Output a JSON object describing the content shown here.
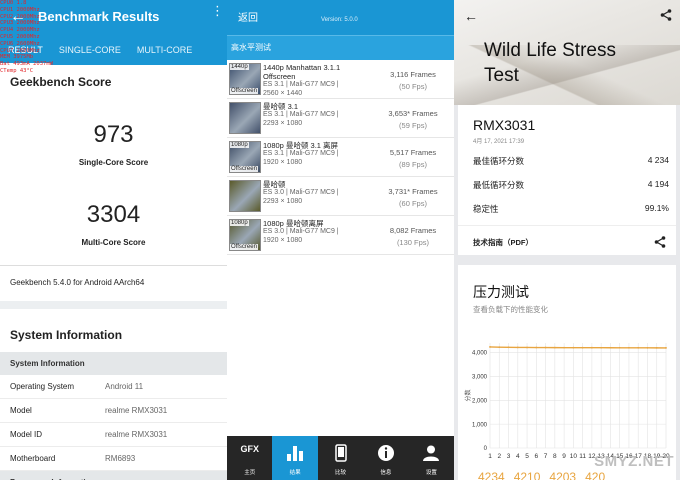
{
  "geekbench": {
    "app_title": "Benchmark Results",
    "overlay_lines": [
      "CPU0 1.8",
      "CPU1 2000Mhz",
      "CPU2 2000Mhz",
      "CPU3 2000Mhz",
      "CPU4 2000Mhz",
      "CPU5 2000Mhz",
      "CPU6 2600Mhz",
      "CPU7 2600Mhz",
      "MEM 3975Mb",
      "Bat 493mA 2037mW",
      "CTemp 43°C"
    ],
    "tabs": [
      "RESULT",
      "SINGLE-CORE",
      "MULTI-CORE"
    ],
    "score_heading": "Geekbench Score",
    "single_core_score": "973",
    "single_core_label": "Single-Core Score",
    "multi_core_score": "3304",
    "multi_core_label": "Multi-Core Score",
    "version_text": "Geekbench 5.4.0 for Android AArch64",
    "system_information_title": "System Information",
    "system_information_subhead": "System Information",
    "rows": [
      {
        "key": "Operating System",
        "value": "Android 11"
      },
      {
        "key": "Model",
        "value": "realme RMX3031"
      },
      {
        "key": "Model ID",
        "value": "realme RMX3031"
      },
      {
        "key": "Motherboard",
        "value": "RM6893"
      }
    ],
    "processor_subhead": "Processor Information"
  },
  "gfx": {
    "back_label": "返回",
    "version": "Version: 5.0.0",
    "section_title": "高水平测试",
    "tests": [
      {
        "thumb_tag": "1440p",
        "thumb_tag2": "Offscreen",
        "name": "1440p Manhattan 3.1.1 Offscreen",
        "api": "ES 3.1 | Mali-G77 MC9 |",
        "res": "2560 × 1440",
        "frames": "3,116 Frames",
        "fps": "(50 Fps)",
        "color": "#3a4d6b"
      },
      {
        "thumb_tag": "",
        "thumb_tag2": "",
        "name": "曼哈顿 3.1",
        "api": "ES 3.1 | Mali-G77 MC9 |",
        "res": "2293 × 1080",
        "frames": "3,653* Frames",
        "fps": "(59 Fps)",
        "color": "#42506a"
      },
      {
        "thumb_tag": "1080p",
        "thumb_tag2": "Offscreen",
        "name": "1080p 曼哈顿 3.1 离屏",
        "api": "ES 3.1 | Mali-G77 MC9 |",
        "res": "1920 × 1080",
        "frames": "5,517 Frames",
        "fps": "(89 Fps)",
        "color": "#3b4a63"
      },
      {
        "thumb_tag": "",
        "thumb_tag2": "",
        "name": "曼哈顿",
        "api": "ES 3.0 | Mali-G77 MC9 |",
        "res": "2293 × 1080",
        "frames": "3,731* Frames",
        "fps": "(60 Fps)",
        "color": "#5a5a2a"
      },
      {
        "thumb_tag": "1080p",
        "thumb_tag2": "Offscreen",
        "name": "1080p 曼哈顿离屏",
        "api": "ES 3.0 | Mali-G77 MC9 |",
        "res": "1920 × 1080",
        "frames": "8,082 Frames",
        "fps": "(130 Fps)",
        "color": "#56582c"
      }
    ],
    "nav": [
      {
        "label": "主页",
        "icon": "gfx-logo-icon",
        "glyph": "GFX"
      },
      {
        "label": "结果",
        "icon": "bar-chart-icon",
        "glyph": ""
      },
      {
        "label": "比较",
        "icon": "phone-icon",
        "glyph": ""
      },
      {
        "label": "信息",
        "icon": "info-icon",
        "glyph": "i"
      },
      {
        "label": "设置",
        "icon": "user-icon",
        "glyph": ""
      }
    ]
  },
  "threedmark": {
    "title_line1": "Wild Life Stress",
    "title_line2": "Test",
    "device": "RMX3031",
    "date": "4月 17, 2021 17:39",
    "best_label": "最佳循环分数",
    "best_value": "4 234",
    "lowest_label": "最低循环分数",
    "lowest_value": "4 194",
    "stability_label": "稳定性",
    "stability_value": "99.1%",
    "tech_guide": "技术指南（PDF）",
    "stress_title": "压力测试",
    "stress_sub": "查看负载下的性能变化",
    "loop_scores": [
      "4234",
      "4210",
      "4203",
      "420"
    ],
    "watermark": "SMYZ.NET",
    "accent": "#e8a540"
  },
  "chart_data": {
    "type": "line",
    "title": "",
    "xlabel": "",
    "ylabel": "分数",
    "x": [
      1,
      2,
      3,
      4,
      5,
      6,
      7,
      8,
      9,
      10,
      11,
      12,
      13,
      14,
      15,
      16,
      17,
      18,
      19,
      20
    ],
    "series": [
      {
        "values": [
          4234,
          4225,
          4220,
          4215,
          4212,
          4210,
          4208,
          4206,
          4205,
          4204,
          4203,
          4203,
          4202,
          4201,
          4200,
          4199,
          4198,
          4197,
          4196,
          4194
        ]
      }
    ],
    "yticks": [
      0,
      1000,
      2000,
      3000,
      4000
    ],
    "ylim": [
      0,
      4400
    ],
    "grid": true
  }
}
